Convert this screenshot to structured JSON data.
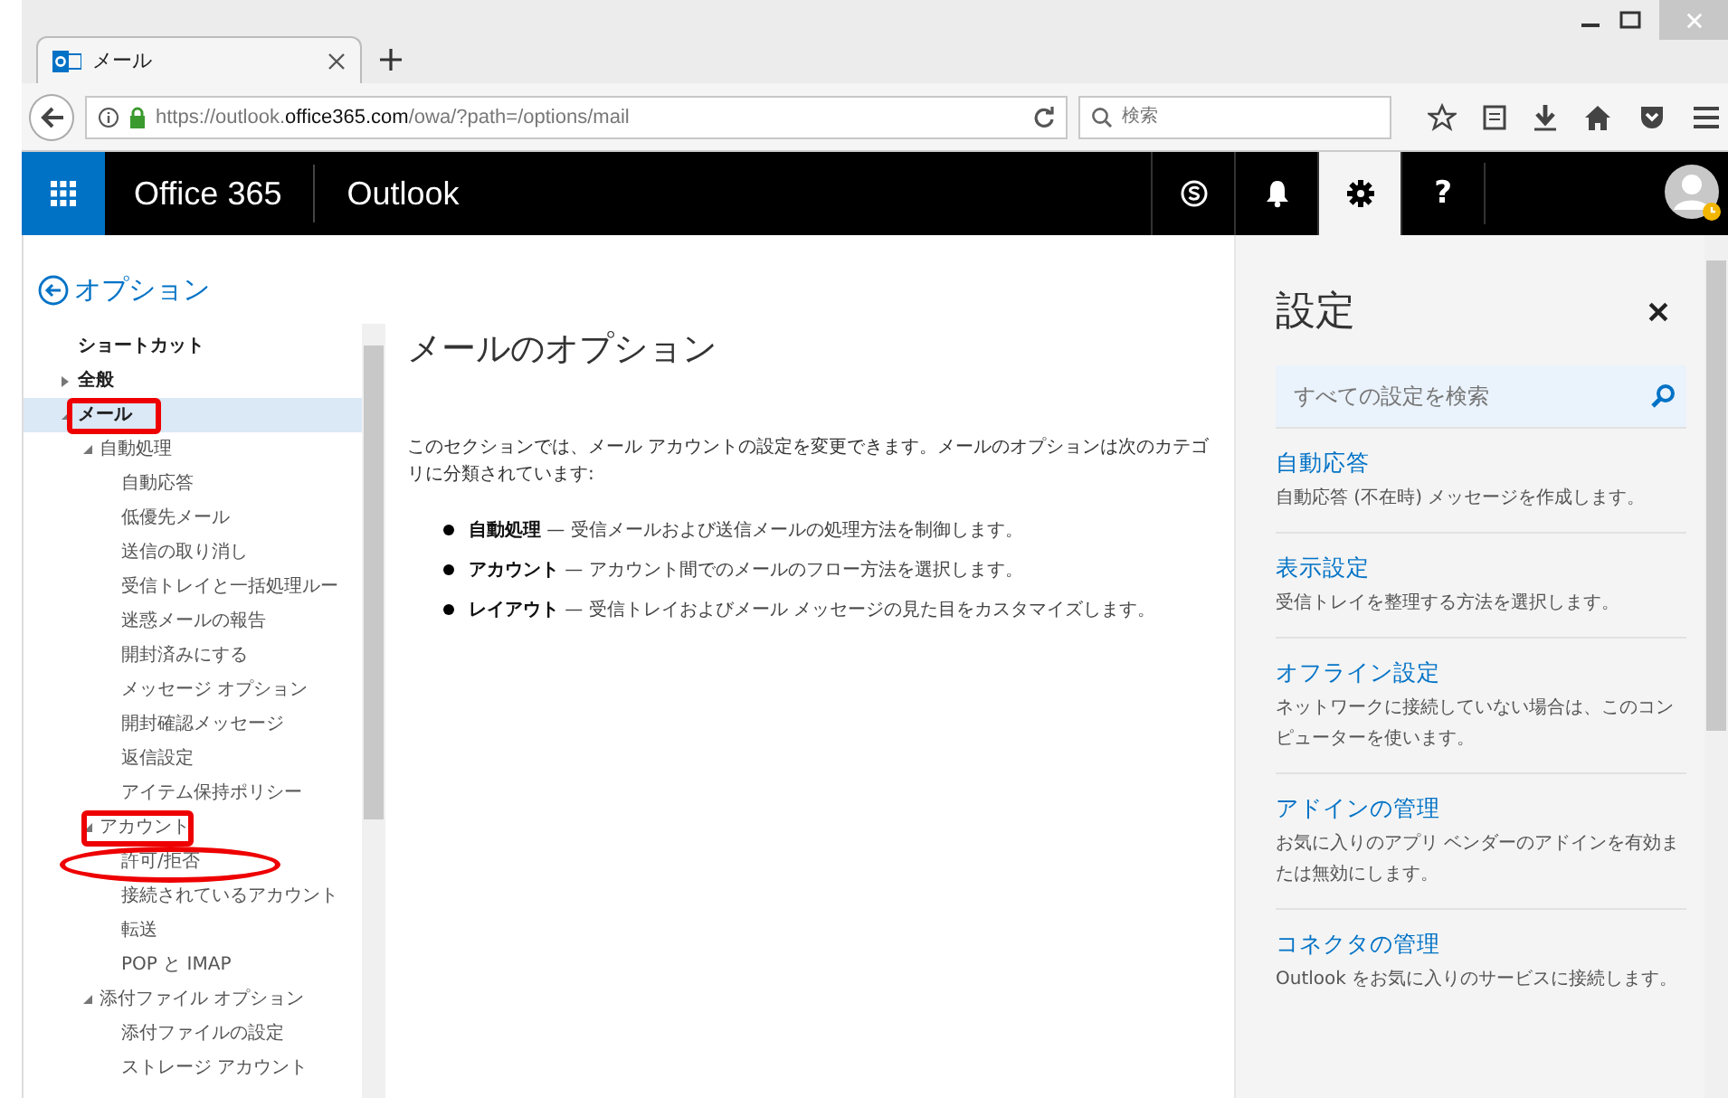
{
  "browser": {
    "tab": {
      "title": "メール"
    },
    "url": "https://outlook.**office365.com**/owa/?path=/options/mail",
    "search": {
      "placeholder": "検索"
    }
  },
  "app_bar": {
    "suite": "Office 365",
    "app": "Outlook",
    "buttons": [
      {
        "kind": "skype",
        "selected": false
      },
      {
        "kind": "bell",
        "selected": false
      },
      {
        "kind": "gear",
        "selected": true
      },
      {
        "kind": "help",
        "label": "?",
        "selected": false
      }
    ]
  },
  "options": {
    "back_label": "オプション",
    "nav": [
      {
        "label": "ショートカット",
        "selected": false
      },
      {
        "label": "全般",
        "expanded": false,
        "selected": false
      },
      {
        "label": "メール",
        "expanded": true,
        "selected": true,
        "boxed": true,
        "children": [
          {
            "label": "自動処理",
            "expanded": true,
            "selected": false,
            "children": [
              {
                "label": "自動応答",
                "selected": false
              },
              {
                "label": "低優先メール",
                "selected": false
              },
              {
                "label": "送信の取り消し",
                "selected": false
              },
              {
                "label": "受信トレイと一括処理ルー",
                "selected": false
              },
              {
                "label": "迷惑メールの報告",
                "selected": false
              },
              {
                "label": "開封済みにする",
                "selected": false
              },
              {
                "label": "メッセージ オプション",
                "selected": false
              },
              {
                "label": "開封確認メッセージ",
                "selected": false
              },
              {
                "label": "返信設定",
                "selected": false
              },
              {
                "label": "アイテム保持ポリシー",
                "selected": false
              }
            ]
          },
          {
            "label": "アカウント",
            "expanded": true,
            "selected": false,
            "boxed": true,
            "children": [
              {
                "label": "許可/拒否",
                "selected": false,
                "circled": true
              },
              {
                "label": "接続されているアカウント",
                "selected": false
              },
              {
                "label": "転送",
                "selected": false
              },
              {
                "label": "POP と IMAP",
                "selected": false
              }
            ]
          },
          {
            "label": "添付ファイル オプション",
            "expanded": true,
            "selected": false,
            "children": [
              {
                "label": "添付ファイルの設定",
                "selected": false
              },
              {
                "label": "ストレージ アカウント",
                "selected": false
              }
            ]
          }
        ]
      }
    ]
  },
  "main": {
    "title": "メールのオプション",
    "intro": "このセクションでは、メール アカウントの設定を変更できます。メールのオプションは次のカテゴリに分類されています:",
    "bullets": [
      {
        "term": "自動処理",
        "text": "— 受信メールおよび送信メールの処理方法を制御します。"
      },
      {
        "term": "アカウント",
        "text": "— アカウント間でのメールのフロー方法を選択します。"
      },
      {
        "term": "レイアウト",
        "text": "— 受信トレイおよびメール メッセージの見た目をカスタマイズします。"
      }
    ]
  },
  "settings": {
    "title": "設定",
    "search": {
      "placeholder": "すべての設定を検索"
    },
    "items": [
      {
        "title": "自動応答",
        "description": "自動応答 (不在時) メッセージを作成します。"
      },
      {
        "title": "表示設定",
        "description": "受信トレイを整理する方法を選択します。"
      },
      {
        "title": "オフライン設定",
        "description": "ネットワークに接続していない場合は、このコンピューターを使います。"
      },
      {
        "title": "アドインの管理",
        "description": "お気に入りのアプリ ベンダーのアドインを有効または無効にします。"
      },
      {
        "title": "コネクタの管理",
        "description": "Outlook をお気に入りのサービスに接続します。"
      }
    ]
  }
}
